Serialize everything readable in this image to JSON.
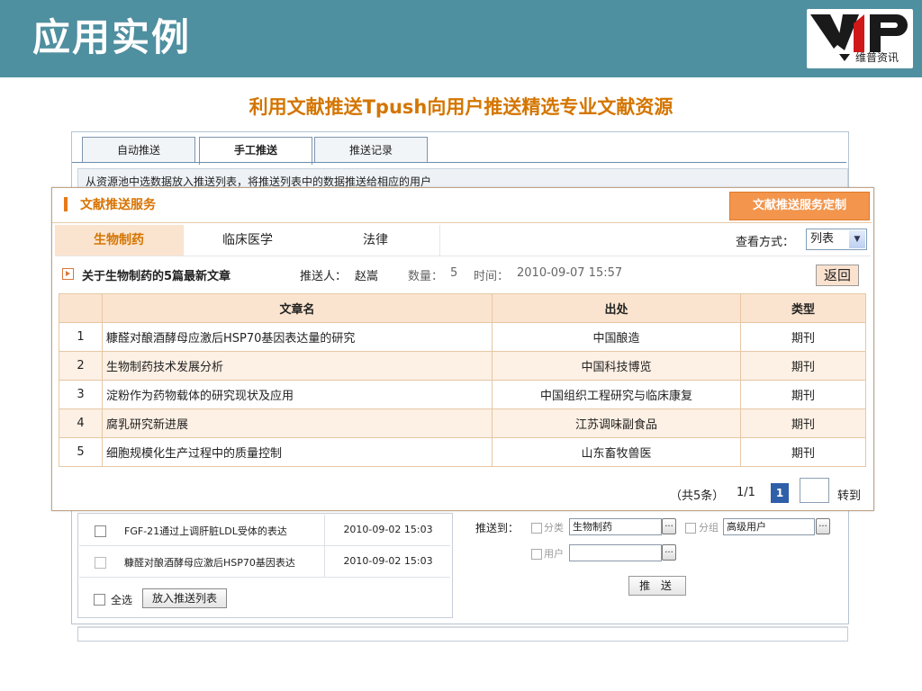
{
  "slide": {
    "title": "应用实例",
    "subtitle": "利用文献推送Tpush向用户推送精选专业文献资源",
    "logo_text": "维普资讯"
  },
  "background_window": {
    "tabs": [
      {
        "label": "自动推送",
        "active": false
      },
      {
        "label": "手工推送",
        "active": true
      },
      {
        "label": "推送记录",
        "active": false
      }
    ],
    "info_text": "从资源池中选数据放入推送列表，将推送列表中的数据推送给相应的用户",
    "articles": [
      {
        "name": "FGF-21通过上调肝脏LDL受体的表达",
        "date": "2010-09-02 15:03"
      },
      {
        "name": "糠醛对酿酒酵母应激后HSP70基因表达",
        "date": "2010-09-02 15:03"
      }
    ],
    "select_all_label": "全选",
    "add_to_list_button": "放入推送列表",
    "push_to_label": "推送到：",
    "category_label": "分类",
    "category_value": "生物制药",
    "group_label": "分组",
    "group_value": "高级用户",
    "user_label": "用户",
    "user_value": "",
    "dots": "...",
    "push_button": "推 送"
  },
  "popup": {
    "title": "文献推送服务",
    "customize_button": "文献推送服务定制",
    "category_tabs": [
      {
        "label": "生物制药",
        "active": true
      },
      {
        "label": "临床医学",
        "active": false
      },
      {
        "label": "法律",
        "active": false
      }
    ],
    "view_label": "查看方式：",
    "view_value": "列表",
    "info": {
      "title": "关于生物制药的5篇最新文章",
      "pusher_label": "推送人：",
      "pusher": "赵嵩",
      "count_label": "数量：",
      "count": "5",
      "time_label": "时间：",
      "time": "2010-09-07 15:57"
    },
    "back_button": "返回",
    "table": {
      "headers": {
        "num": "",
        "name": "文章名",
        "source": "出处",
        "type": "类型"
      },
      "rows": [
        {
          "num": "1",
          "name": "糠醛对酿酒酵母应激后HSP70基因表达量的研究",
          "source": "中国酿造",
          "type": "期刊"
        },
        {
          "num": "2",
          "name": "生物制药技术发展分析",
          "source": "中国科技博览",
          "type": "期刊"
        },
        {
          "num": "3",
          "name": "淀粉作为药物载体的研究现状及应用",
          "source": "中国组织工程研究与临床康复",
          "type": "期刊"
        },
        {
          "num": "4",
          "name": "腐乳研究新进展",
          "source": "江苏调味副食品",
          "type": "期刊"
        },
        {
          "num": "5",
          "name": "细胞规模化生产过程中的质量控制",
          "source": "山东畜牧兽医",
          "type": "期刊"
        }
      ]
    },
    "pager": {
      "total": "（共5条）",
      "page": "1/1",
      "current": "1",
      "input_value": "",
      "go_label": "转到"
    }
  },
  "colors": {
    "header_band": "#4e8fa0",
    "subtitle": "#d47500",
    "accent_orange": "#f3954c",
    "table_header": "#fbe4cf",
    "page_current": "#2f5fa8"
  }
}
